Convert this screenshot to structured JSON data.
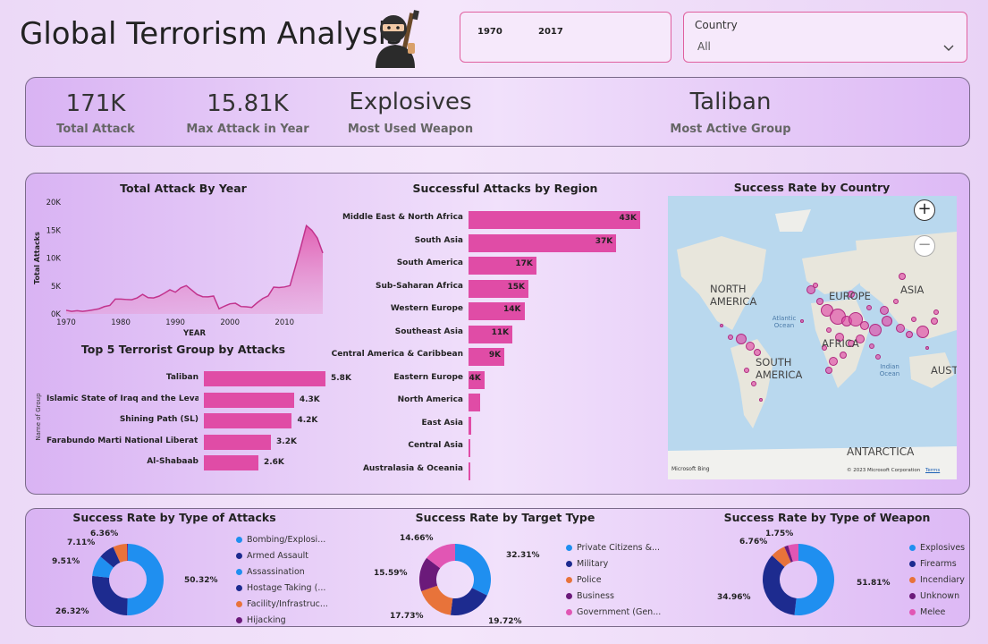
{
  "header": {
    "title": "Global Terrorism Analysis",
    "year_start": "1970",
    "year_end": "2017",
    "country_label": "Country",
    "country_value": "All"
  },
  "kpis": {
    "total_attack_value": "171K",
    "total_attack_label": "Total Attack",
    "max_attack_value": "15.81K",
    "max_attack_label": "Max Attack in Year",
    "weapon_value": "Explosives",
    "weapon_label": "Most Used Weapon",
    "group_value": "Taliban",
    "group_label": "Most Active Group"
  },
  "colors": {
    "accent": "#e04ca6",
    "blue": "#1f8ff0",
    "navy": "#1d2b8f",
    "orange": "#e8733a",
    "purple": "#6b1a7a",
    "pink": "#e156b4"
  },
  "chart_data": [
    {
      "type": "area",
      "title": "Total Attack By Year",
      "xlabel": "YEAR",
      "ylabel": "Total Attacks",
      "x_ticks": [
        "1970",
        "1980",
        "1990",
        "2000",
        "2010"
      ],
      "y_ticks": [
        "0K",
        "5K",
        "10K",
        "15K",
        "20K"
      ],
      "ylim": [
        0,
        20000
      ],
      "x": [
        1970,
        1971,
        1972,
        1973,
        1974,
        1975,
        1976,
        1977,
        1978,
        1979,
        1980,
        1981,
        1982,
        1983,
        1984,
        1985,
        1986,
        1987,
        1988,
        1989,
        1990,
        1991,
        1992,
        1994,
        1995,
        1996,
        1997,
        1998,
        1999,
        2000,
        2001,
        2002,
        2003,
        2004,
        2005,
        2006,
        2007,
        2008,
        2009,
        2010,
        2011,
        2012,
        2013,
        2014,
        2015,
        2016,
        2017
      ],
      "y": [
        650,
        470,
        570,
        470,
        580,
        740,
        920,
        1320,
        1530,
        2660,
        2660,
        2590,
        2540,
        2870,
        3500,
        2920,
        2860,
        3180,
        3720,
        4320,
        3890,
        4680,
        5070,
        3460,
        3080,
        3060,
        3200,
        930,
        1400,
        1810,
        1910,
        1330,
        1280,
        1170,
        2020,
        2760,
        3240,
        4800,
        4720,
        4830,
        5070,
        8500,
        12040,
        15810,
        14960,
        13590,
        10900
      ]
    },
    {
      "type": "bar",
      "title": "Successful Attacks by Region",
      "categories": [
        "Middle East & North Africa",
        "South Asia",
        "South America",
        "Sub-Saharan Africa",
        "Western Europe",
        "Southeast Asia",
        "Central America & Caribbean",
        "Eastern Europe",
        "North America",
        "East Asia",
        "Central Asia",
        "Australasia & Oceania"
      ],
      "values": [
        43000,
        37000,
        17000,
        15000,
        14000,
        11000,
        9000,
        4000,
        2900,
        700,
        500,
        250
      ],
      "labels": [
        "43K",
        "37K",
        "17K",
        "15K",
        "14K",
        "11K",
        "9K",
        "4K",
        "",
        "",
        "",
        ""
      ]
    },
    {
      "type": "bar",
      "title": "Top 5 Terrorist Group by Attacks",
      "ylabel": "Name of Group",
      "categories": [
        "Taliban",
        "Islamic State of Iraq and the Levant (IS...",
        "Shining Path (SL)",
        "Farabundo Marti National Liberation F...",
        "Al-Shabaab"
      ],
      "values": [
        5800,
        4300,
        4200,
        3200,
        2600
      ],
      "labels": [
        "5.8K",
        "4.3K",
        "4.2K",
        "3.2K",
        "2.6K"
      ]
    },
    {
      "type": "pie",
      "title": "Success Rate by Type of Attacks",
      "categories": [
        "Bombing/Explosi...",
        "Armed Assault",
        "Assassination",
        "Hostage Taking (...",
        "Facility/Infrastruc...",
        "Hijacking"
      ],
      "values": [
        50.32,
        26.32,
        9.51,
        7.11,
        6.36,
        0.38
      ],
      "labels": [
        "50.32%",
        "26.32%",
        "9.51%",
        "7.11%",
        "6.36%",
        ""
      ],
      "colors": [
        "#1f8ff0",
        "#1d2b8f",
        "#1f8ff0",
        "#1d2b8f",
        "#e8733a",
        "#6b1a7a"
      ]
    },
    {
      "type": "pie",
      "title": "Success Rate by Target Type",
      "categories": [
        "Private Citizens &...",
        "Military",
        "Police",
        "Business",
        "Government (Gen..."
      ],
      "values": [
        32.31,
        19.72,
        17.73,
        15.59,
        14.66
      ],
      "labels": [
        "32.31%",
        "19.72%",
        "17.73%",
        "15.59%",
        "14.66%"
      ],
      "colors": [
        "#1f8ff0",
        "#1d2b8f",
        "#e8733a",
        "#6b1a7a",
        "#e156b4"
      ]
    },
    {
      "type": "pie",
      "title": "Success Rate by Type of Weapon",
      "categories": [
        "Explosives",
        "Firearms",
        "Incendiary",
        "Unknown",
        "Melee"
      ],
      "values": [
        51.81,
        34.96,
        6.76,
        1.75,
        4.72
      ],
      "labels": [
        "51.81%",
        "34.96%",
        "6.76%",
        "1.75%",
        ""
      ],
      "colors": [
        "#1f8ff0",
        "#1d2b8f",
        "#e8733a",
        "#6b1a7a",
        "#e156b4"
      ]
    }
  ],
  "map": {
    "title": "Success Rate by Country",
    "labels": [
      "NORTH AMERICA",
      "SOUTH AMERICA",
      "EUROPE",
      "ASIA",
      "AFRICA",
      "AUSTRALIA",
      "ANTARCTICA"
    ],
    "ocean_labels": [
      "Atlantic Ocean",
      "Indian Ocean"
    ],
    "credit": "© 2023 Microsoft Corporation",
    "terms": "Terms",
    "brand": "Microsoft Bing",
    "zoom_in": "+",
    "zoom_out": "−"
  }
}
